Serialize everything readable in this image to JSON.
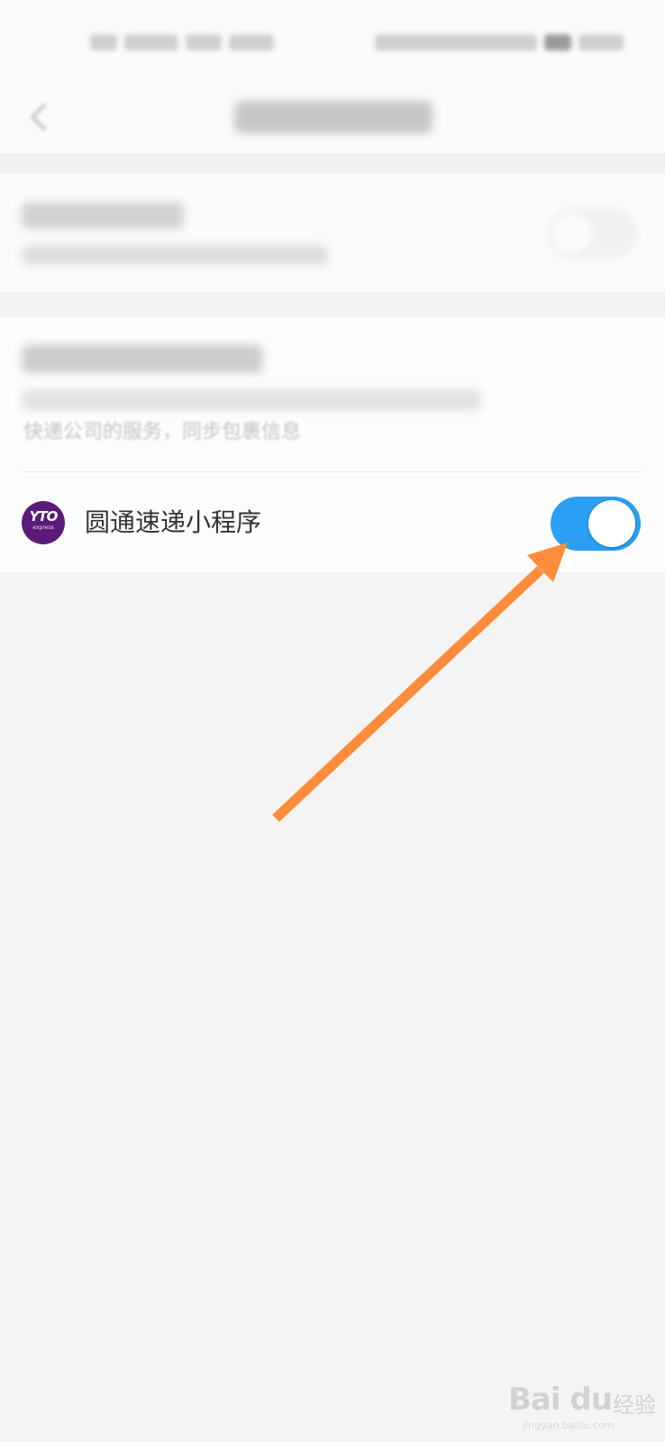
{
  "miniprogram": {
    "name": "圆通速递小程序",
    "logo_text": "YTO",
    "logo_sub": "express",
    "toggle_on": true,
    "toggle_color": "#2a9ff3"
  },
  "section2": {
    "description_line2": "快递公司的服务，同步包裹信息"
  },
  "navigation": {
    "back_icon": "chevron-left-icon"
  },
  "annotation": {
    "arrow_color": "#ff8c3a"
  },
  "watermark": {
    "logo": "Bai du",
    "cn": "经验",
    "url": "jingyan.baidu.com"
  },
  "colors": {
    "page_background": "#f4f4f4",
    "card_background": "#fdfdfd",
    "text_primary": "#333333"
  }
}
